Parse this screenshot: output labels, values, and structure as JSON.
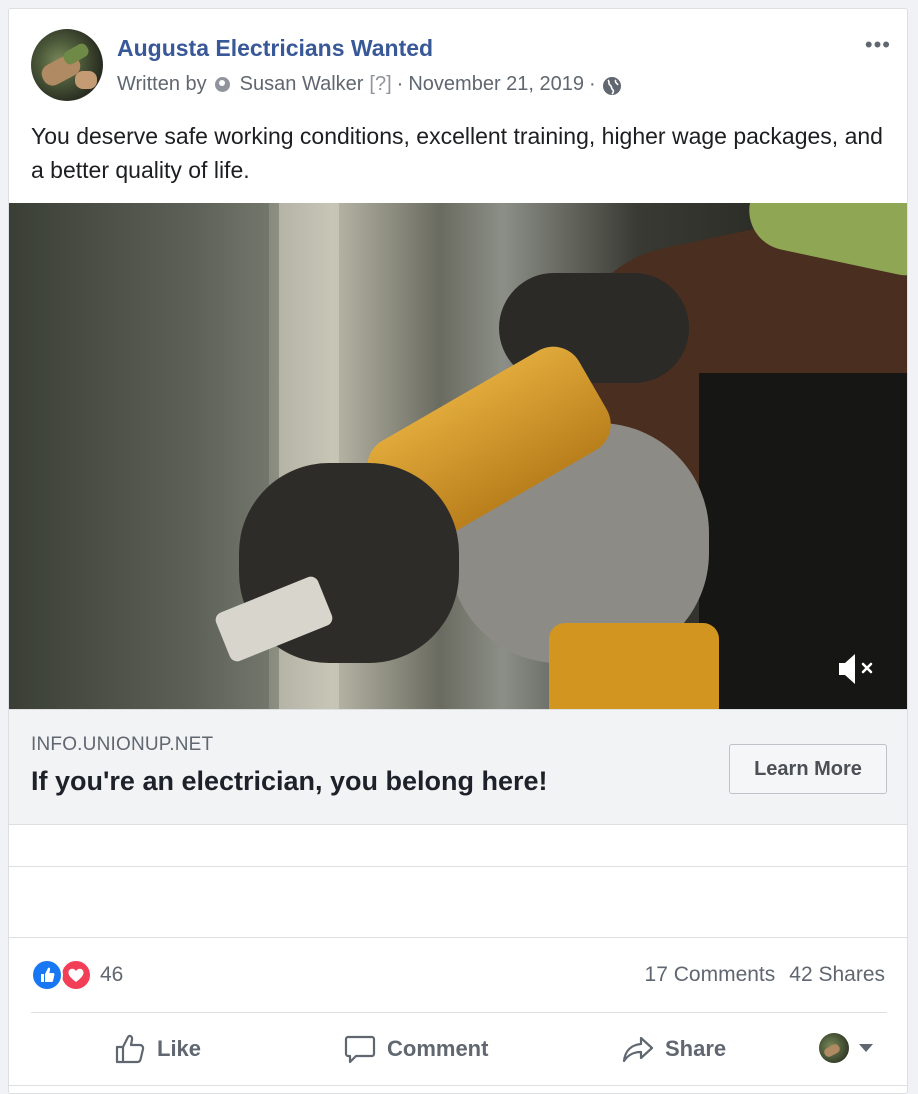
{
  "post": {
    "page_name": "Augusta Electricians Wanted",
    "written_by_prefix": "Written by",
    "author": "Susan Walker",
    "author_info": "[?]",
    "separator": "·",
    "date": "November 21, 2019",
    "audience_icon": "globe-icon",
    "more_icon": "more-options-icon",
    "more_glyph": "•••",
    "text": "You deserve safe working conditions, excellent training, higher wage packages, and a better quality of life."
  },
  "video": {
    "mute_icon": "volume-muted-icon"
  },
  "link_preview": {
    "domain": "INFO.UNIONUP.NET",
    "title": "If you're an electrician, you belong here!",
    "cta_label": "Learn More"
  },
  "engagement": {
    "reaction_icons": [
      "like-reaction-icon",
      "love-reaction-icon"
    ],
    "reaction_count": "46",
    "comments": "17 Comments",
    "shares": "42 Shares"
  },
  "actions": {
    "like_label": "Like",
    "comment_label": "Comment",
    "share_label": "Share"
  },
  "colors": {
    "link_blue": "#385898",
    "secondary_text": "#606770",
    "like_blue": "#1877f2",
    "love_red": "#f33e58",
    "preview_bg": "#f2f3f5"
  }
}
